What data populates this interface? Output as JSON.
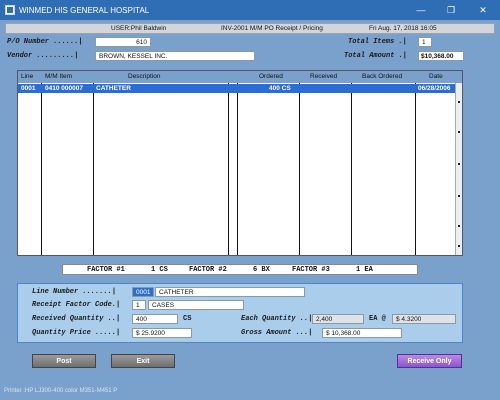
{
  "window": {
    "title": "WINMED HIS GENERAL HOSPITAL",
    "minimize": "—",
    "maximize": "❐",
    "close": "✕"
  },
  "header": {
    "user": "USER:Phil Baldwin",
    "screen": "INV-2001   M/M PO Receipt / Pricing",
    "datetime": "Fri Aug. 17, 2018 16:05"
  },
  "po": {
    "po_label": "P/O Number ......|",
    "po_value": "610",
    "vendor_label": "Vendor .........|",
    "vendor_value": "BROWN, KESSEL INC.",
    "total_items_label": "Total Items .|",
    "total_items_value": "1",
    "total_amount_label": "Total Amount .|",
    "total_amount_value": "$10,368.00"
  },
  "grid": {
    "columns": [
      "Line",
      "M/M Item",
      "Description",
      "Ordered",
      "Received",
      "Back Ordered",
      "Date"
    ],
    "rows": [
      {
        "line": "0001",
        "item": "0410 000007",
        "description": "CATHETER",
        "ordered": "400 CS",
        "received": "",
        "back_ordered": "",
        "date": "06/28/2006"
      }
    ]
  },
  "factors": {
    "f1_label": "FACTOR #1",
    "f1_value": "1 CS",
    "f2_label": "FACTOR #2",
    "f2_value": "6 BX",
    "f3_label": "FACTOR #3",
    "f3_value": "1 EA"
  },
  "detail": {
    "line_number_label": "Line Number .......|",
    "line_number_value": "0001",
    "line_desc": "CATHETER",
    "receipt_factor_label": "Receipt Factor Code.|",
    "receipt_factor_value": "1",
    "receipt_factor_desc": "CASES",
    "received_qty_label": "Received Quantity ..|",
    "received_qty_value": "400",
    "received_qty_unit": "CS",
    "each_qty_label": "Each Quantity ..|",
    "each_qty_value": "2,400",
    "each_unit": "EA @",
    "each_price": "$ 4.3200",
    "qty_price_label": "Quantity Price .....|",
    "qty_price_value": "$ 25.9200",
    "gross_amount_label": "Gross Amount ...|",
    "gross_amount_value": "$ 10,368.00"
  },
  "buttons": {
    "post": "Post",
    "exit": "Exit",
    "receive_only": "Receive Only"
  },
  "status": {
    "printer": "Printer :HP LJ300-400 color M351-M451 P"
  },
  "colors": {
    "titlebar": "#2f6db5",
    "background": "#7aa1cc",
    "selected_row": "#2a6fcf",
    "panel": "#a9cdea",
    "receive_only": "#8a55cc"
  }
}
